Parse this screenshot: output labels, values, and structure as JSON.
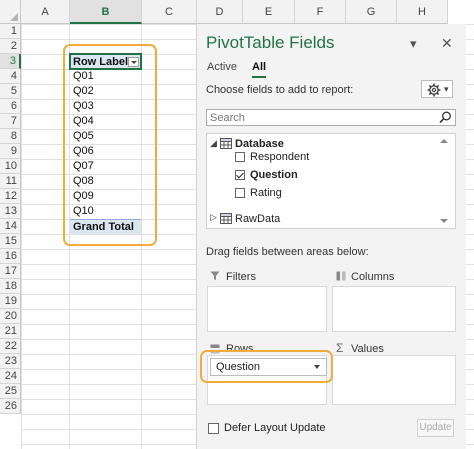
{
  "sheet": {
    "columns": [
      "A",
      "B",
      "C",
      "D",
      "E",
      "F",
      "G",
      "H"
    ],
    "selected_column": "B",
    "rows": [
      "1",
      "2",
      "3",
      "4",
      "5",
      "6",
      "7",
      "8",
      "9",
      "10",
      "11",
      "12",
      "13",
      "14",
      "15",
      "16",
      "17",
      "18",
      "19",
      "20",
      "21",
      "22",
      "23",
      "24",
      "25",
      "26"
    ],
    "selected_row": "3"
  },
  "pivot_table": {
    "header_label": "Row Labels",
    "items": [
      "Q01",
      "Q02",
      "Q03",
      "Q04",
      "Q05",
      "Q06",
      "Q07",
      "Q08",
      "Q09",
      "Q10"
    ],
    "grand_total_label": "Grand Total"
  },
  "pane": {
    "title": "PivotTable Fields",
    "tabs": [
      {
        "label": "Active",
        "active": false
      },
      {
        "label": "All",
        "active": true
      }
    ],
    "choose_fields_label": "Choose fields to add to report:",
    "search_placeholder": "Search",
    "tables": [
      {
        "name": "Database",
        "expanded": true,
        "fields": [
          {
            "label": "Respondent",
            "checked": false
          },
          {
            "label": "Question",
            "checked": true
          },
          {
            "label": "Rating",
            "checked": false
          }
        ]
      },
      {
        "name": "RawData",
        "expanded": false
      }
    ],
    "drag_label": "Drag fields between areas below:",
    "areas": {
      "filters": "Filters",
      "columns": "Columns",
      "rows": "Rows",
      "values": "Values"
    },
    "rows_field": "Question",
    "defer_label": "Defer Layout Update",
    "update_label": "Update"
  },
  "colors": {
    "accent": "#217346",
    "highlight": "#f0ad3e",
    "pivot_header": "#dce6f1"
  }
}
